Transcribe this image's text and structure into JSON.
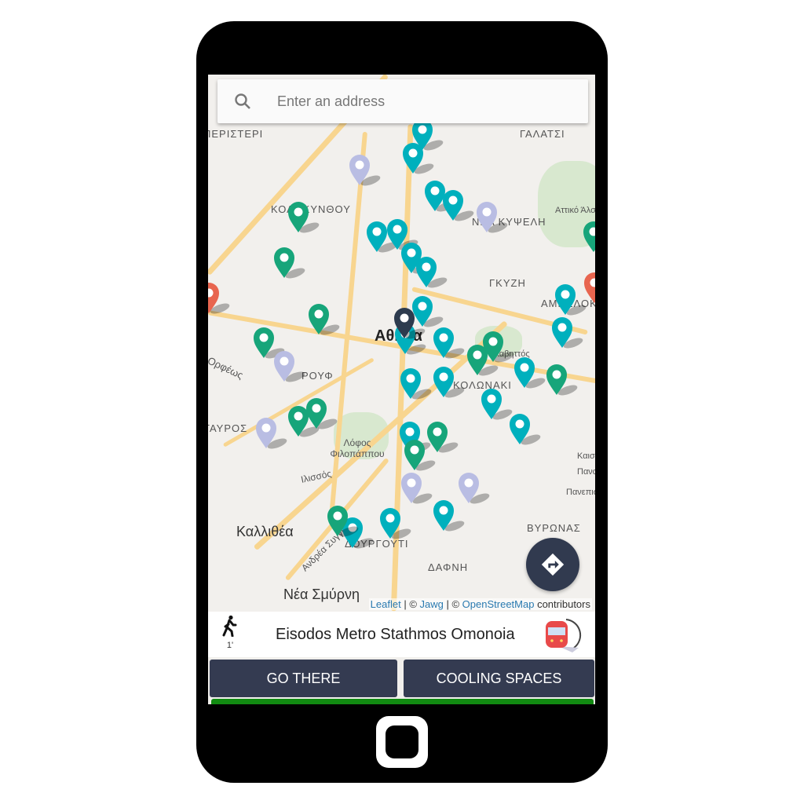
{
  "search": {
    "placeholder": "Enter an address",
    "icon": "search-icon"
  },
  "map": {
    "labels": [
      "ΠΕΡΙΣΤΕΡΙ",
      "ΓΑΛΑΤΣΙ",
      "ΚΟΛΟΚΥΝΘΟΥ",
      "Αττικό Άλσος",
      "ΝΕΑ ΚΥΨΕΛΗ",
      "ΓΚΥΖΗ",
      "ΑΜΠΕΛΟΚΗΠΟΙ",
      "Αθήνα",
      "ΡΟΥΦ",
      "Ορφέως",
      "ΚΟΛΩΝΑΚΙ",
      "Λυκαβηττός",
      "ΤΑΥΡΟΣ",
      "Λόφος Φιλοπάππου",
      "Ιλισσός",
      "Καλλιθέα",
      "Ανδρέα Συγγρού",
      "ΔΟΥΡΓΟΥΤΙ",
      "ΒΥΡΩΝΑΣ",
      "ΔΑΦΝΗ",
      "Νέα Σμύρνη",
      "Καισαριανή",
      "Παναγία",
      "Πανεπιστ."
    ],
    "marker_colors": {
      "teal": "#00b0bd",
      "green": "#17a57a",
      "lavender": "#b9bde3",
      "red": "#e8654f",
      "selected": "#2d3b4e"
    },
    "attribution": {
      "leaflet": "Leaflet",
      "sep1": " | © ",
      "jawg": "Jawg",
      "sep2": " | © ",
      "osm": "OpenStreetMap",
      "suffix": " contributors"
    }
  },
  "directions_button": {
    "icon": "directions-icon"
  },
  "info": {
    "walk_icon": "walking-icon",
    "walk_time": "1'",
    "destination": "Eisodos Metro Stathmos Omonoia",
    "type_icon": "metro-icon"
  },
  "buttons": {
    "go_there": "GO THERE",
    "cooling_spaces": "COOLING SPACES"
  },
  "accent": "#118a11"
}
